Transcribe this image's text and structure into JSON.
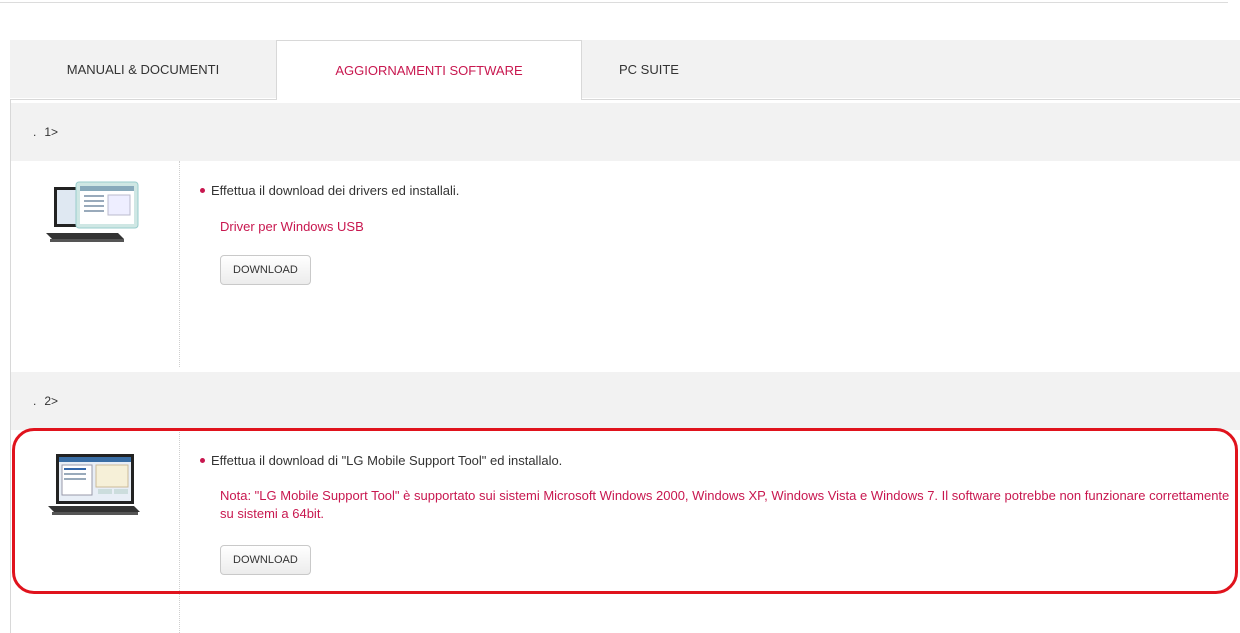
{
  "tabs": [
    {
      "label": "MANUALI & DOCUMENTI"
    },
    {
      "label": "AGGIORNAMENTI SOFTWARE"
    },
    {
      "label": "PC SUITE"
    }
  ],
  "steps": [
    {
      "marker": "1>",
      "instruction": "Effettua il download dei drivers ed installali.",
      "link": "Driver per Windows USB",
      "button": "DOWNLOAD"
    },
    {
      "marker": "2>",
      "instruction": "Effettua il download di \"LG Mobile Support Tool\" ed installalo.",
      "note": "Nota: \"LG Mobile Support Tool\" è supportato sui sistemi Microsoft Windows 2000, Windows XP, Windows Vista e Windows 7. Il software potrebbe non funzionare correttamente su sistemi a 64bit.",
      "button": "DOWNLOAD"
    }
  ],
  "colors": {
    "accent": "#c8174f",
    "highlight_ring": "#e0131d",
    "header_bg": "#f2f2f2"
  }
}
